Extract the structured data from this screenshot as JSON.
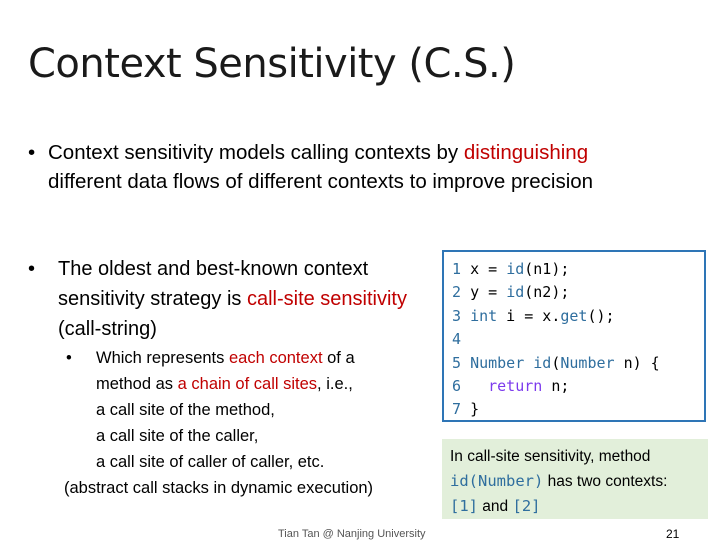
{
  "slide": {
    "title": "Context Sensitivity (C.S.)",
    "bullet_char": "•",
    "sub_bullet_char": "•",
    "bullet1": {
      "part1": "Context sensitivity models calling contexts by ",
      "highlight": "distinguishing",
      "part2": "different data flows of different contexts to improve precision"
    },
    "bullet2": {
      "part1": "The oldest and best-known context sensitivity strategy is ",
      "highlight": "call-site sensitivity",
      "part2": " (call-string)"
    },
    "sub_bullet": {
      "line1_a": "Which represents ",
      "line1_highlight": "each context",
      "line1_b": " of a",
      "line2_a": "method as ",
      "line2_highlight": "a chain of call sites",
      "line2_b": ", i.e.,",
      "line3": "a call site of the method,",
      "line4": "a call site of the caller,",
      "line5": "a call site of caller of caller, etc.",
      "line6": "(abstract call stacks in dynamic execution)"
    },
    "code": {
      "lines": [
        {
          "num": "1",
          "text": "x = id(n1);"
        },
        {
          "num": "2",
          "text": "y = id(n2);"
        },
        {
          "num": "3",
          "text": "int i = x.get();"
        },
        {
          "num": "4",
          "text": ""
        },
        {
          "num": "5",
          "text": "Number id(Number n) {"
        },
        {
          "num": "6",
          "text": "  return n;"
        },
        {
          "num": "7",
          "text": "}"
        }
      ]
    },
    "note": {
      "line1": "In call-site sensitivity, method",
      "code1": "id(Number)",
      "line2": " has two contexts:",
      "ctx1": "[1]",
      "and": " and ",
      "ctx2": "[2]"
    },
    "footer": "Tian Tan @ Nanjing University",
    "page_number": "21",
    "colors": {
      "highlight": "#c00000",
      "code_border": "#2e75b6",
      "note_bg": "#e2efda",
      "code_keyword": "#2f6e9e"
    }
  }
}
